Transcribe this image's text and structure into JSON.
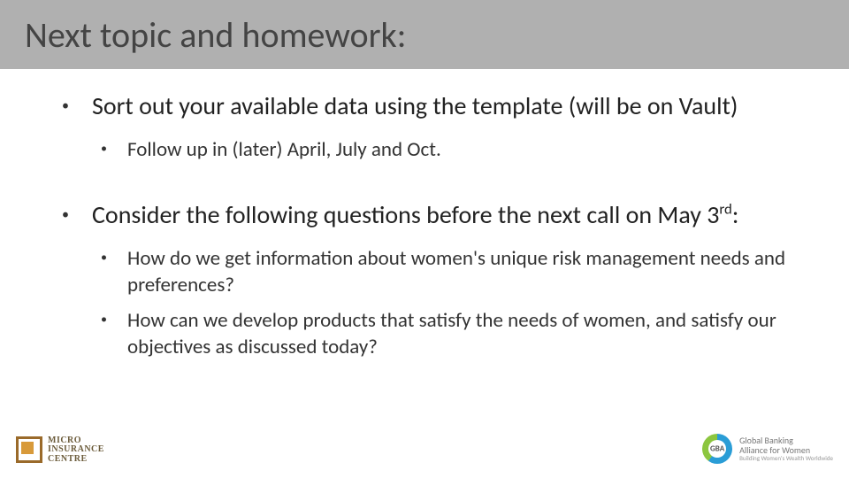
{
  "title": "Next topic and homework:",
  "bullets": [
    {
      "text": "Sort out your available data using the template (will be on Vault)",
      "sub": [
        "Follow up in (later) April, July and Oct."
      ]
    },
    {
      "text_html": "Consider the following questions before the next call on May 3<sup>rd</sup>:",
      "sub": [
        "How do we get information about women's unique risk management needs and preferences?",
        "How can we develop products that satisfy the needs of women, and satisfy our objectives as discussed today?"
      ]
    }
  ],
  "logo_left": {
    "line1": "Micro",
    "line2": "Insurance",
    "line3": "Centre"
  },
  "logo_right": {
    "abbr": "GBA",
    "line1": "Global Banking",
    "line2": "Alliance for Women",
    "tagline": "Building Women's Wealth Worldwide"
  }
}
